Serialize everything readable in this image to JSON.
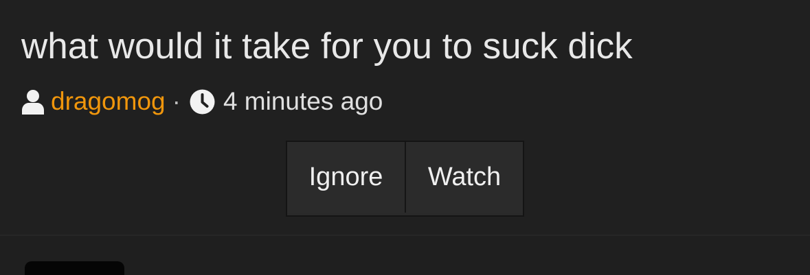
{
  "thread": {
    "title": "what would it take for you to suck dick",
    "author": "dragomog",
    "separator": "·",
    "time_ago": "4 minutes ago"
  },
  "actions": {
    "ignore_label": "Ignore",
    "watch_label": "Watch"
  },
  "icons": {
    "author": "user-icon",
    "time": "clock-icon"
  },
  "colors": {
    "background": "#202020",
    "author_link": "#f0960c",
    "text": "#e8e8e8",
    "button_bg": "#2b2b2b"
  }
}
